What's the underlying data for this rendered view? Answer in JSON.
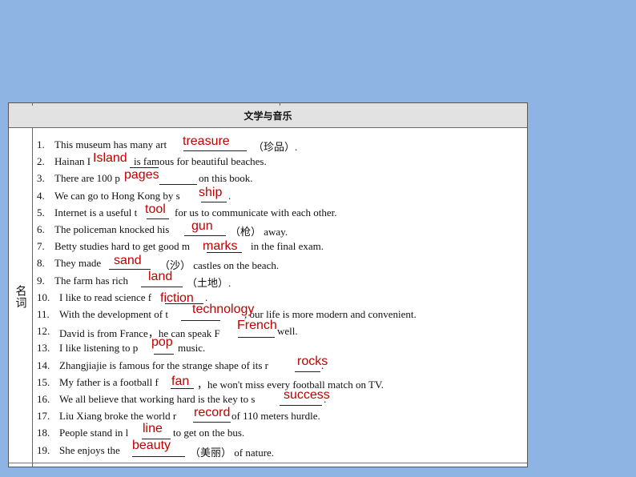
{
  "table": {
    "header": "文学与音乐",
    "category": "名词"
  },
  "rows": [
    {
      "num": "1.",
      "before": "This museum has many art",
      "after": "（珍品）.",
      "answer": "treasure"
    },
    {
      "num": "2.",
      "before": "Hainan I",
      "after": "is famous for beautiful beaches.",
      "answer": "Island"
    },
    {
      "num": "3.",
      "before": "There are 100 p",
      "after": "on this book.",
      "answer": "pages"
    },
    {
      "num": "4.",
      "before": "We can go to Hong Kong by s",
      "after": ".",
      "answer": "ship"
    },
    {
      "num": "5.",
      "before": "Internet is a useful t",
      "after": "for us to communicate with each other.",
      "answer": "tool"
    },
    {
      "num": "6.",
      "before": "The policeman knocked his",
      "after": "（枪） away.",
      "answer": "gun"
    },
    {
      "num": "7.",
      "before": "Betty studies hard to get good m",
      "after": "in the final exam.",
      "answer": "marks"
    },
    {
      "num": "8.",
      "before": "They made",
      "after": "（沙） castles on the beach.",
      "answer": "sand"
    },
    {
      "num": "9.",
      "before": "The farm has rich",
      "after": "（土地）.",
      "answer": "land"
    },
    {
      "num": "10.",
      "before": "I like to read science f",
      "after": ".",
      "answer": "fiction"
    },
    {
      "num": "11.",
      "before": "With the development of t",
      "after": ", our life is more modern and convenient.",
      "answer": "technology"
    },
    {
      "num": "12.",
      "before": "David is from France，he can speak F",
      "after": "well.",
      "answer": "French"
    },
    {
      "num": "13.",
      "before": "I like listening to p",
      "after": "music.",
      "answer": "pop"
    },
    {
      "num": "14.",
      "before": "Zhangjiajie is famous for the strange shape of its r",
      "after": ".",
      "answer": "rocks"
    },
    {
      "num": "15.",
      "before": "My father is a football f",
      "after": "，he won't miss every football match on TV.",
      "answer": "fan"
    },
    {
      "num": "16.",
      "before": "We all believe that working hard is the key to s",
      "after": ".",
      "answer": "success"
    },
    {
      "num": "17.",
      "before": "Liu Xiang broke the world r",
      "after": "of 110 meters hurdle.",
      "answer": "record"
    },
    {
      "num": "18.",
      "before": "People stand in l",
      "after": "to get on the bus.",
      "answer": "line"
    },
    {
      "num": "19.",
      "before": "She enjoys the",
      "after": "（美丽） of nature.",
      "answer": "beauty"
    }
  ]
}
